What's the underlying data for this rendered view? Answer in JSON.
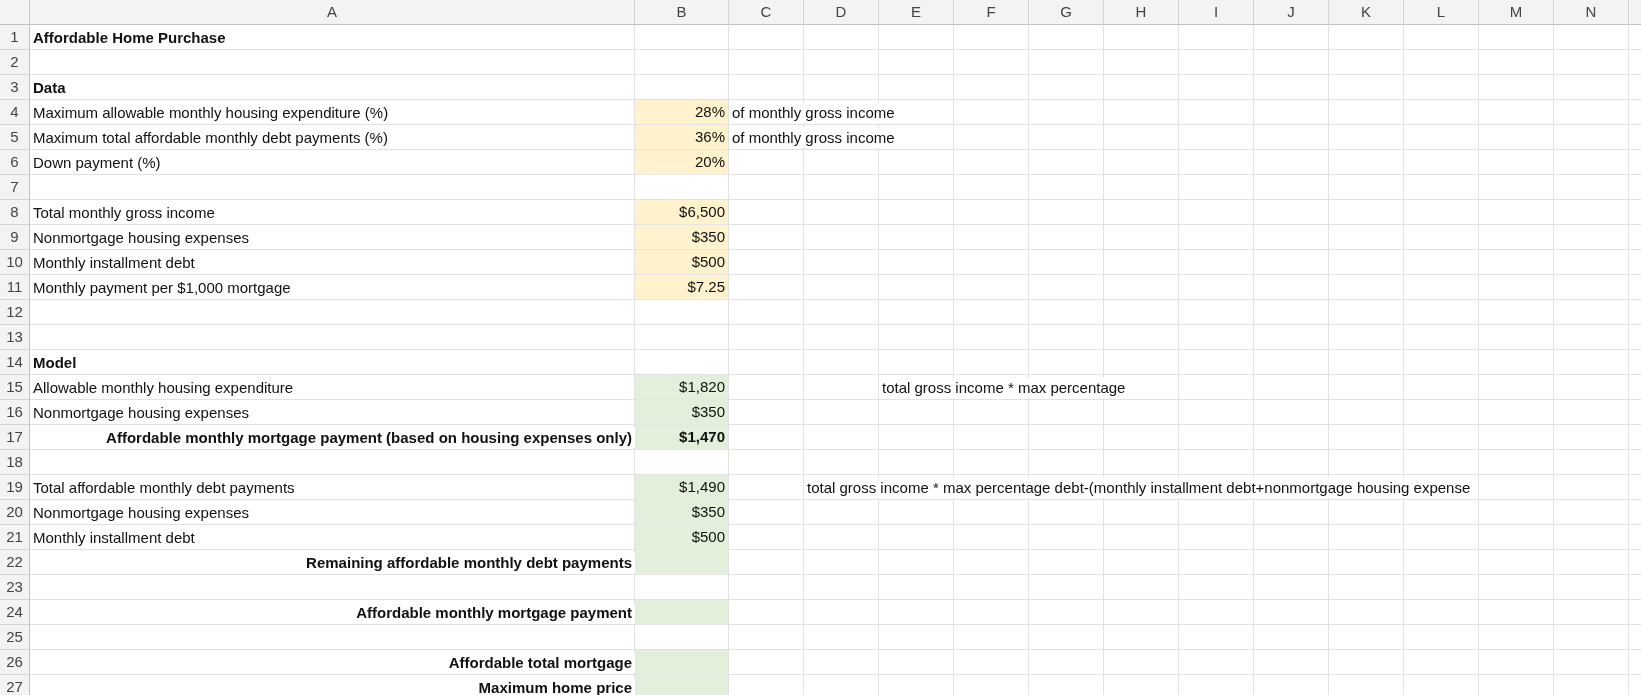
{
  "columns": [
    "A",
    "B",
    "C",
    "D",
    "E",
    "F",
    "G",
    "H",
    "I",
    "J",
    "K",
    "L",
    "M",
    "N"
  ],
  "rows": [
    {
      "number": "1",
      "A": {
        "text": "Affordable Home Purchase",
        "kind": "heading"
      }
    },
    {
      "number": "2"
    },
    {
      "number": "3",
      "A": {
        "text": "Data",
        "kind": "heading"
      }
    },
    {
      "number": "4",
      "A": {
        "text": "Maximum allowable monthly housing expenditure (%)",
        "kind": "item"
      },
      "B": {
        "text": "28%",
        "kind": "input",
        "bold": false
      },
      "C": {
        "text": "of monthly gross income"
      }
    },
    {
      "number": "5",
      "A": {
        "text": "Maximum total affordable monthly debt payments (%)",
        "kind": "item"
      },
      "B": {
        "text": "36%",
        "kind": "input",
        "bold": false
      },
      "C": {
        "text": "of monthly gross income"
      }
    },
    {
      "number": "6",
      "A": {
        "text": "Down payment (%)",
        "kind": "item"
      },
      "B": {
        "text": "20%",
        "kind": "input",
        "bold": false
      }
    },
    {
      "number": "7"
    },
    {
      "number": "8",
      "A": {
        "text": "Total monthly gross income",
        "kind": "item"
      },
      "B": {
        "text": "$6,500",
        "kind": "input",
        "bold": false
      }
    },
    {
      "number": "9",
      "A": {
        "text": "Nonmortgage housing expenses",
        "kind": "item"
      },
      "B": {
        "text": "$350",
        "kind": "input",
        "bold": false
      }
    },
    {
      "number": "10",
      "A": {
        "text": "Monthly installment debt",
        "kind": "item"
      },
      "B": {
        "text": "$500",
        "kind": "input",
        "bold": false
      }
    },
    {
      "number": "11",
      "A": {
        "text": "Monthly payment per $1,000 mortgage",
        "kind": "item"
      },
      "B": {
        "text": "$7.25",
        "kind": "input",
        "bold": false
      }
    },
    {
      "number": "12"
    },
    {
      "number": "13"
    },
    {
      "number": "14",
      "A": {
        "text": "Model",
        "kind": "heading"
      }
    },
    {
      "number": "15",
      "A": {
        "text": "Allowable monthly housing expenditure",
        "kind": "item"
      },
      "B": {
        "text": "$1,820",
        "kind": "calc",
        "bold": false
      },
      "E": {
        "text": "total gross income * max percentage"
      }
    },
    {
      "number": "16",
      "A": {
        "text": "Nonmortgage housing expenses",
        "kind": "item"
      },
      "B": {
        "text": "$350",
        "kind": "calc",
        "bold": false
      }
    },
    {
      "number": "17",
      "A": {
        "text": "Affordable monthly mortgage payment (based on housing expenses only)",
        "kind": "total"
      },
      "B": {
        "text": "$1,470",
        "kind": "calc",
        "bold": true
      }
    },
    {
      "number": "18"
    },
    {
      "number": "19",
      "A": {
        "text": "Total affordable monthly debt payments",
        "kind": "item"
      },
      "B": {
        "text": "$1,490",
        "kind": "calc",
        "bold": false
      },
      "D": {
        "text": "total gross income * max percentage debt-(monthly installment debt+nonmortgage housing expense"
      }
    },
    {
      "number": "20",
      "A": {
        "text": "Nonmortgage housing expenses",
        "kind": "item"
      },
      "B": {
        "text": "$350",
        "kind": "calc",
        "bold": false
      }
    },
    {
      "number": "21",
      "A": {
        "text": "Monthly installment debt",
        "kind": "item"
      },
      "B": {
        "text": "$500",
        "kind": "calc",
        "bold": false
      }
    },
    {
      "number": "22",
      "A": {
        "text": "Remaining affordable monthly debt payments",
        "kind": "total"
      },
      "B": {
        "kind": "calc"
      }
    },
    {
      "number": "23"
    },
    {
      "number": "24",
      "A": {
        "text": "Affordable monthly mortgage payment",
        "kind": "total"
      },
      "B": {
        "kind": "calc"
      }
    },
    {
      "number": "25"
    },
    {
      "number": "26",
      "A": {
        "text": "Affordable total mortgage",
        "kind": "total"
      },
      "B": {
        "kind": "calc"
      }
    },
    {
      "number": "27",
      "A": {
        "text": "Maximum home price",
        "kind": "total"
      },
      "B": {
        "kind": "calc"
      }
    }
  ]
}
